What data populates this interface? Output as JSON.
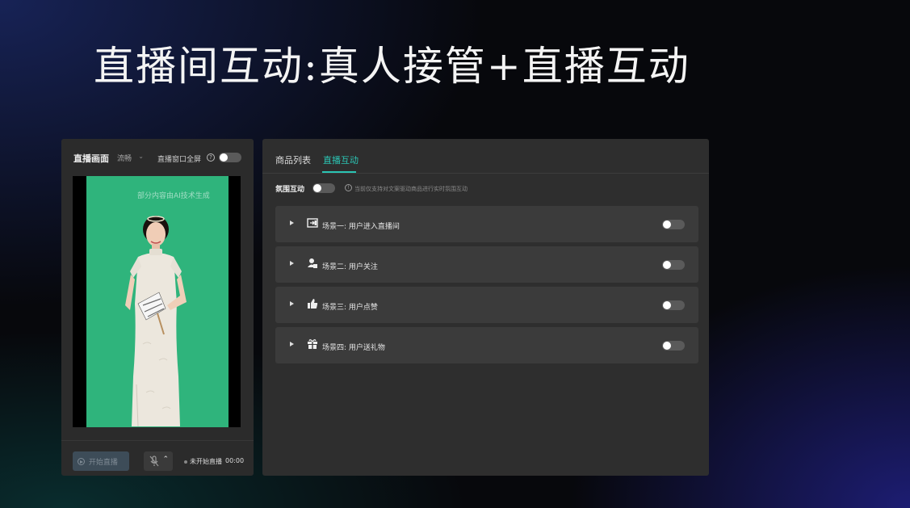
{
  "slide": {
    "title": "直播间互动:真人接管+直播互动"
  },
  "left_panel": {
    "title": "直播画面",
    "quality": "流畅",
    "fullscreen_label": "直播窗口全屏",
    "help_icon": "?",
    "fullscreen_enabled": false,
    "ai_notice": "部分内容由AI技术生成",
    "start_button": "开始直播",
    "status_text": "未开始直播",
    "status_time": "00:00",
    "colors": {
      "green_screen": "#2fb47c",
      "start_button_bg": "#3d4c58"
    }
  },
  "right_panel": {
    "tabs": [
      {
        "label": "商品列表",
        "active": false
      },
      {
        "label": "直播互动",
        "active": true
      }
    ],
    "atmosphere": {
      "label": "氛围互动",
      "enabled": false,
      "info_icon": "!",
      "tip": "当前仅支持对文案驱动商品进行实时氛围互动"
    },
    "scenes": [
      {
        "label": "场景一: 用户进入直播间",
        "icon": "enter-room-icon",
        "enabled": false
      },
      {
        "label": "场景二: 用户关注",
        "icon": "follow-user-icon",
        "enabled": false
      },
      {
        "label": "场景三: 用户点赞",
        "icon": "thumbs-up-icon",
        "enabled": false
      },
      {
        "label": "场景四: 用户送礼物",
        "icon": "gift-icon",
        "enabled": false
      }
    ],
    "colors": {
      "accent": "#2bc5b4"
    }
  }
}
